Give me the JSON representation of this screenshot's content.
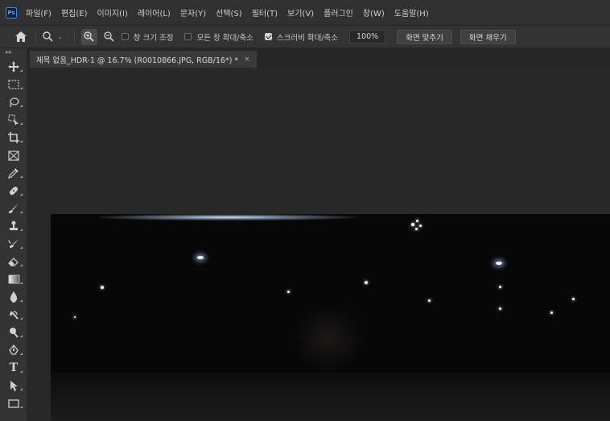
{
  "app": {
    "logo_text": "Ps",
    "brand_color": "#31a8ff"
  },
  "menu": [
    {
      "label": "파일(F)"
    },
    {
      "label": "편집(E)"
    },
    {
      "label": "이미지(I)"
    },
    {
      "label": "레이어(L)"
    },
    {
      "label": "문자(Y)"
    },
    {
      "label": "선택(S)"
    },
    {
      "label": "필터(T)"
    },
    {
      "label": "보기(V)"
    },
    {
      "label": "플러그인"
    },
    {
      "label": "창(W)"
    },
    {
      "label": "도움말(H)"
    }
  ],
  "options": {
    "home_icon": "home-icon",
    "zoom_icon": "zoom-icon",
    "zoom_in_icon": "zoom-in-icon",
    "zoom_out_icon": "zoom-out-icon",
    "resize_windows": {
      "label": "창 크기 조정",
      "checked": false
    },
    "zoom_all_windows": {
      "label": "모든 창 확대/축소",
      "checked": false
    },
    "scrubby_zoom": {
      "label": "스크러비 확대/축소",
      "checked": true
    },
    "zoom_value": "100%",
    "fit_screen_label": "화면 맞추기",
    "fill_screen_label": "화면 채우기"
  },
  "toolbar": {
    "collapse_glyph": "▸▸",
    "tools": [
      {
        "name": "move-tool",
        "icon": "move-icon"
      },
      {
        "name": "marquee-tool",
        "icon": "marquee-icon"
      },
      {
        "name": "lasso-tool",
        "icon": "lasso-icon"
      },
      {
        "name": "object-select-tool",
        "icon": "object-select-icon"
      },
      {
        "name": "crop-tool",
        "icon": "crop-icon"
      },
      {
        "name": "frame-tool",
        "icon": "frame-icon"
      },
      {
        "name": "eyedropper-tool",
        "icon": "eyedropper-icon"
      },
      {
        "name": "healing-brush-tool",
        "icon": "healing-brush-icon"
      },
      {
        "name": "brush-tool",
        "icon": "brush-icon"
      },
      {
        "name": "clone-stamp-tool",
        "icon": "stamp-icon"
      },
      {
        "name": "history-brush-tool",
        "icon": "history-brush-icon"
      },
      {
        "name": "eraser-tool",
        "icon": "eraser-icon"
      },
      {
        "name": "gradient-tool",
        "icon": "gradient-icon"
      },
      {
        "name": "blur-tool",
        "icon": "blur-icon"
      },
      {
        "name": "dodge-tool",
        "icon": "dodge-icon"
      },
      {
        "name": "burn-tool",
        "icon": "burn-icon"
      },
      {
        "name": "pen-tool",
        "icon": "pen-icon"
      },
      {
        "name": "type-tool",
        "icon": "type-icon",
        "glyph": "T"
      },
      {
        "name": "path-select-tool",
        "icon": "path-select-icon"
      },
      {
        "name": "rectangle-tool",
        "icon": "rectangle-icon"
      }
    ]
  },
  "document": {
    "tab_title": "제목 없음_HDR-1 @ 16.7% (R0010866.JPG, RGB/16*) *",
    "close_glyph": "×"
  },
  "colors": {
    "panel": "#333333",
    "menubar": "#303030",
    "workspace": "#282828",
    "image_bg": "#070708"
  }
}
